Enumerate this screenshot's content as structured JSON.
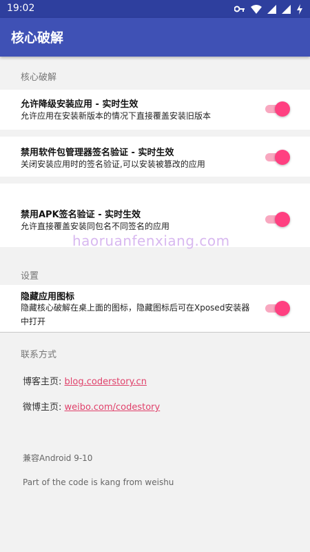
{
  "status_bar": {
    "time": "19:02",
    "icons": [
      "key-icon",
      "wifi-icon",
      "signal-icon",
      "signal-icon",
      "battery-charging-icon"
    ]
  },
  "toolbar": {
    "title": "核心破解"
  },
  "sections": {
    "core": "核心破解",
    "settings": "设置",
    "contact": "联系方式"
  },
  "rows": [
    {
      "title": "允许降级安装应用 - 实时生效",
      "subtitle": "允许应用在安装新版本的情况下直接覆盖安装旧版本",
      "enabled": true
    },
    {
      "title": "禁用软件包管理器签名验证 - 实时生效",
      "subtitle": "关闭安装应用时的签名验证,可以安装被篡改的应用",
      "enabled": true
    },
    {
      "title": "禁用APK签名验证 - 实时生效",
      "subtitle": "允许直接覆盖安装同包名不同签名的应用",
      "enabled": true
    },
    {
      "title": "隐藏应用图标",
      "subtitle": "隐藏核心破解在桌上面的图标，隐藏图标后可在Xposed安装器中打开",
      "enabled": true
    }
  ],
  "contact": {
    "blog_label": "博客主页: ",
    "blog_link": "blog.coderstory.cn",
    "weibo_label": "微博主页: ",
    "weibo_link": "weibo.com/codestory"
  },
  "info": {
    "compat": "兼容Android 9-10",
    "credit": "Part of the code is kang from weishu"
  },
  "watermark": "haoruanfenxiang.com",
  "colors": {
    "primary": "#3f51b5",
    "primary_dark": "#2e3f9e",
    "accent": "#ff4081",
    "link": "#e0406a"
  }
}
